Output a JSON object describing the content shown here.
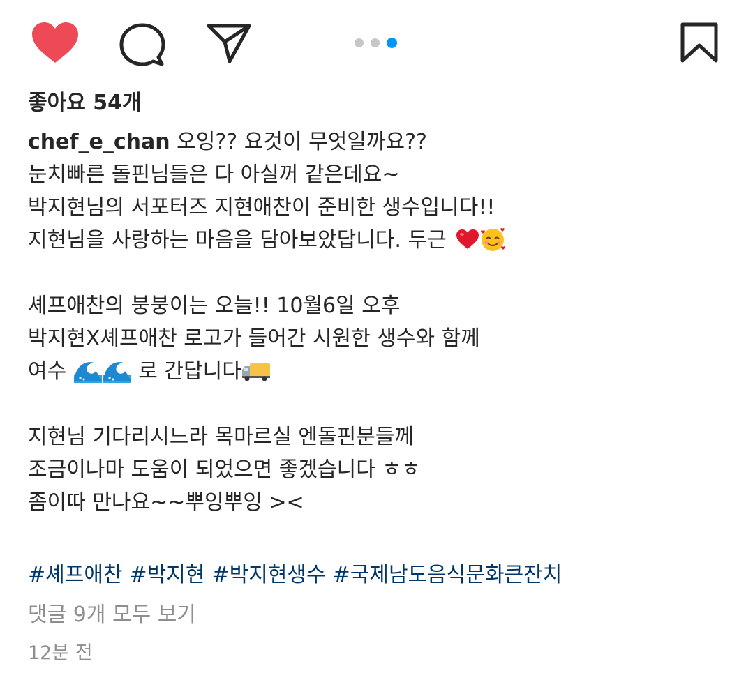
{
  "actions": {
    "like_icon": "heart-filled-icon",
    "comment_icon": "comment-bubble-icon",
    "share_icon": "paper-plane-icon",
    "save_icon": "bookmark-icon",
    "like_color": "#ed4956"
  },
  "carousel": {
    "count": 3,
    "active_index": 2,
    "active_color": "#0095f6"
  },
  "likes_text": "좋아요 54개",
  "caption": {
    "username": "chef_e_chan",
    "line1_rest": " 오잉?? 요것이 무엇일까요??",
    "line2": "눈치빠른 돌핀님들은 다 아실꺼 같은데요~",
    "line3": "박지현님의 서포터즈 지현애찬이 준비한 생수입니다!!",
    "line4": "지현님을 사랑하는 마음을 담아보았답니다. 두근 ",
    "line5": "셰프애찬의 붕붕이는 오늘!! 10월6일 오후",
    "line6": "박지현X셰프애찬 로고가 들어간 시원한 생수와 함께",
    "line7_a": "여수 ",
    "line7_b": " 로 간답니다",
    "line8": "지현님 기다리시느라 목마르실 엔돌핀분들께",
    "line9": "조금이나마 도움이 되었으면 좋겠습니다 ㅎㅎ",
    "line10": "좀이따 만나요~~뿌잉뿌잉 ><",
    "emojis": [
      "red-heart-icon",
      "smiling-face-with-hearts-icon",
      "water-wave-icon",
      "delivery-truck-icon"
    ]
  },
  "hashtags": [
    "#셰프애찬",
    "#박지현",
    "#박지현생수",
    "#국제남도음식문화큰잔치"
  ],
  "hashtag_color": "#00376b",
  "view_comments": "댓글 9개 모두 보기",
  "timestamp": "12분 전"
}
